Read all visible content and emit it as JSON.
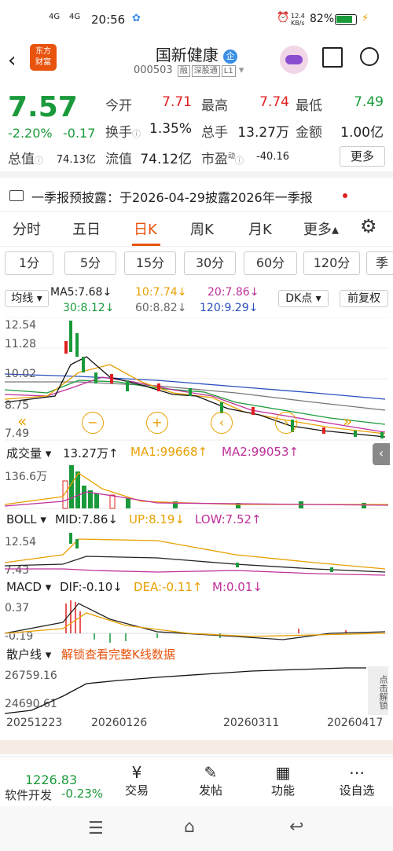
{
  "status": {
    "signal1": "4G",
    "signal2": "4G",
    "time": "20:56",
    "net_speed_value": "12.4",
    "net_speed_unit": "KB/s",
    "battery": "82%"
  },
  "header": {
    "title": "国新健康",
    "badge": "企",
    "code": "000503",
    "tags": [
      "融",
      "深股通",
      "L1"
    ]
  },
  "quote": {
    "price": "7.57",
    "change_pct": "-2.20%",
    "change": "-0.17",
    "open_label": "今开",
    "open": "7.71",
    "high_label": "最高",
    "high": "7.74",
    "low_label": "最低",
    "low": "7.49",
    "turnover_label": "换手",
    "turnover": "1.35%",
    "vol_label": "总手",
    "vol": "13.27万",
    "amount_label": "金额",
    "amount": "1.00亿",
    "mktcap_label": "总值",
    "mktcap": "74.13亿",
    "float_label": "流值",
    "float": "74.12亿",
    "pe_label": "市盈",
    "pe_tag": "动",
    "pe": "-40.16",
    "more": "更多"
  },
  "notice": "一季报预披露：于2026-04-29披露2026年一季报",
  "tabs": [
    "分时",
    "五日",
    "日K",
    "周K",
    "月K",
    "更多▴"
  ],
  "subtabs": [
    "1分",
    "5分",
    "15分",
    "30分",
    "60分",
    "120分",
    "季"
  ],
  "ma": {
    "type": "均线",
    "ma5": "MA5:7.68↓",
    "ma10": "10:7.74↓",
    "ma20": "20:7.86↓",
    "ma30": "30:8.12↓",
    "ma60": "60:8.82↓",
    "ma120": "120:9.29↓",
    "dk": "DK点",
    "fq": "前复权"
  },
  "kaxis": {
    "y1": "12.54",
    "y2": "11.28",
    "y3": "10.02",
    "y4": "8.75",
    "y5": "7.49"
  },
  "vol": {
    "name": "成交量",
    "total": "13.27万↑",
    "ma1": "MA1:99668↑",
    "ma2": "MA2:99053↑",
    "ymax": "136.6万"
  },
  "boll": {
    "name": "BOLL",
    "mid": "MID:7.86↓",
    "up": "UP:8.19↓",
    "low": "LOW:7.52↑",
    "ymax": "12.54",
    "ymin": "7.43"
  },
  "macd": {
    "name": "MACD",
    "dif": "DIF:-0.10↓",
    "dea": "DEA:-0.11↑",
    "m": "M:0.01↓",
    "ymax": "0.37",
    "ymin": "-0.19"
  },
  "retail": {
    "name": "散户线",
    "unlock": "解锁查看完整K线数据",
    "ymax": "26759.16",
    "ymin": "24690.61",
    "side": "点击解锁"
  },
  "dates": [
    "20251223",
    "20260126",
    "20260311",
    "20260417"
  ],
  "index": {
    "value": "1226.83",
    "name": "软件开发",
    "change": "-0.23%"
  },
  "bottom": [
    {
      "label": "交易"
    },
    {
      "label": "发帖"
    },
    {
      "label": "功能"
    },
    {
      "label": "设自选"
    }
  ],
  "colors": {
    "up": "#e02020",
    "down": "#1a9a3a",
    "accent": "#e8530e"
  }
}
